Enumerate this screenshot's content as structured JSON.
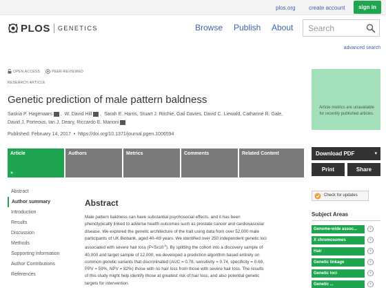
{
  "header": {
    "plos_org": "plos.org",
    "create_account": "create account",
    "sign_in": "sign in"
  },
  "logo": {
    "brand": "PLOS",
    "journal": "GENETICS"
  },
  "nav": {
    "browse": "Browse",
    "publish": "Publish",
    "about": "About"
  },
  "search": {
    "placeholder": "Search",
    "advanced": "advanced search"
  },
  "article": {
    "open_access": "OPEN ACCESS",
    "peer_reviewed": "PEER-REVIEWED",
    "type": "RESEARCH ARTICLE",
    "title": "Genetic prediction of male pattern baldness",
    "authors": [
      "Saskia P. Hagenaars",
      "W. David Hill",
      "Sarah E. Harris, Stuart J. Ritchie, Gail Davies, David C. Liewald, Catharine R. Gale,",
      "David J. Porteous, Ian J. Deary, Riccardo E. Marioni"
    ],
    "published": "Published: February 14, 2017",
    "doi": "https://doi.org/10.1371/journal.pgen.1006594"
  },
  "metrics": {
    "text": "Article metrics are unavailable for recently published articles."
  },
  "tabs": [
    "Article",
    "Authors",
    "Metrics",
    "Comments",
    "Related Content"
  ],
  "sidebar": {
    "items": [
      "Abstract",
      "Author summary",
      "Introduction",
      "Results",
      "Discussion",
      "Methods",
      "Supporting information",
      "Author Contributions",
      "References"
    ],
    "active_index": 1
  },
  "abstract": {
    "heading": "Abstract",
    "lines": [
      "Male pattern baldness can have substantial psychosocial effects, and it has been",
      "phenotypically linked to adverse health outcomes such as prostate cancer and cardiovascular",
      "disease. We explored the genetic architecture of the trait using data from over 52,000 male",
      "participants of UK Biobank, aged 40–69 years. We identified over 250 independent genetic loci",
      "associated with severe hair loss (P<5x10",
      "40,000 and target sample of 12,000, we developed a prediction algorithm based entirely on",
      "common genetic variants that discriminated (AUC = 0.78, sensitivity = 0.74, specificity = 0.69,",
      "PPV = 59%, NPV = 82%) those with no hair loss from those with severe hair loss. The results",
      "of this study might help identify those at greatest risk of hair loss, and also potential genetic",
      "targets for intervention."
    ],
    "sup": "-8",
    "line5_tail": "). By splitting the cohort into a discovery sample of"
  },
  "actions": {
    "download": "Download PDF",
    "print": "Print",
    "share": "Share",
    "check_updates": "Check for updates"
  },
  "subjects": {
    "heading": "Subject Areas",
    "items": [
      "Genome-wide assoc...",
      "X chromosomes",
      "Hair",
      "Genetic linkage",
      "Genetic loci",
      "Genetic ..."
    ]
  },
  "colors": {
    "accent": "#1fa54f",
    "link": "#3c63af",
    "tab_inactive": "#7a7a7a",
    "metrics_bg": "#a3e0b9"
  }
}
